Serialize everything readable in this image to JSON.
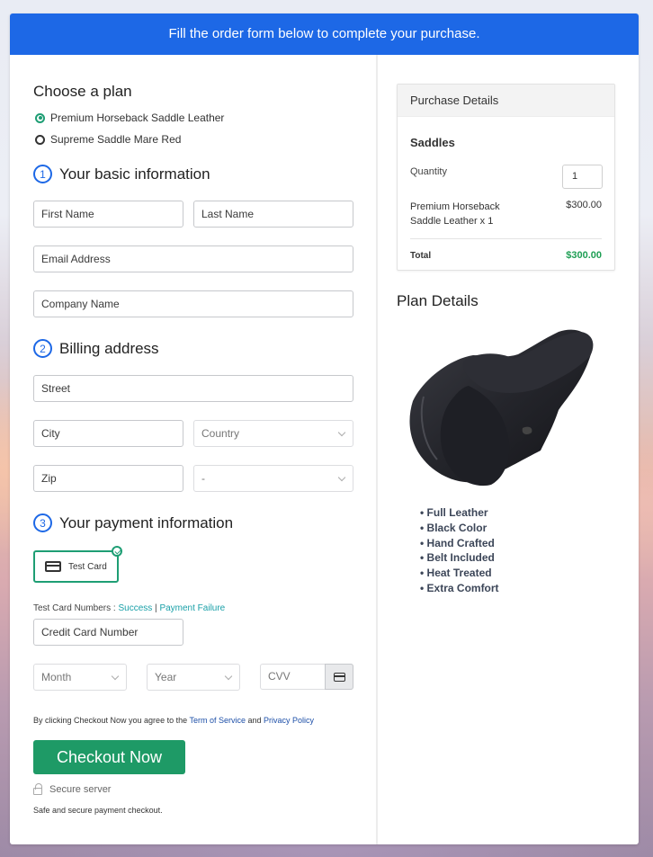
{
  "banner": {
    "text": "Fill the order form below to complete your purchase."
  },
  "plan": {
    "title": "Choose a plan",
    "options": [
      {
        "label": "Premium Horseback Saddle Leather",
        "selected": true
      },
      {
        "label": "Supreme Saddle Mare Red",
        "selected": false
      }
    ]
  },
  "basic": {
    "step": "1",
    "title": "Your basic information",
    "first_name": "First Name",
    "last_name": "Last Name",
    "email": "Email Address",
    "company": "Company Name"
  },
  "billing": {
    "step": "2",
    "title": "Billing address",
    "street": "Street",
    "city": "City",
    "country": "Country",
    "zip": "Zip",
    "state": "-"
  },
  "payment": {
    "step": "3",
    "title": "Your payment information",
    "method_label": "Test Card",
    "test_numbers_label": "Test Card Numbers : ",
    "success_link": "Success",
    "separator": " | ",
    "failure_link": "Payment Failure",
    "card_number": "Credit Card Number",
    "month": "Month",
    "year": "Year",
    "cvv": "CVV"
  },
  "agreement": {
    "prefix": "By clicking Checkout Now you agree to the ",
    "terms": "Term of Service",
    "and": " and ",
    "privacy": "Privacy Policy"
  },
  "checkout": {
    "button": "Checkout Now",
    "secure": "Secure server",
    "safe": "Safe and secure payment checkout."
  },
  "purchase": {
    "title": "Purchase Details",
    "product": "Saddles",
    "quantity_label": "Quantity",
    "quantity": "1",
    "item": "Premium Horseback Saddle Leather x 1",
    "item_price": "$300.00",
    "total_label": "Total",
    "total": "$300.00"
  },
  "plan_details": {
    "title": "Plan Details",
    "features": [
      "Full Leather",
      "Black Color",
      "Hand Crafted",
      "Belt Included",
      "Heat Treated",
      "Extra Comfort"
    ]
  },
  "colors": {
    "primary": "#1d68e6",
    "success": "#1e9a66",
    "link": "#1aa0a8",
    "total": "#1e9e54"
  }
}
